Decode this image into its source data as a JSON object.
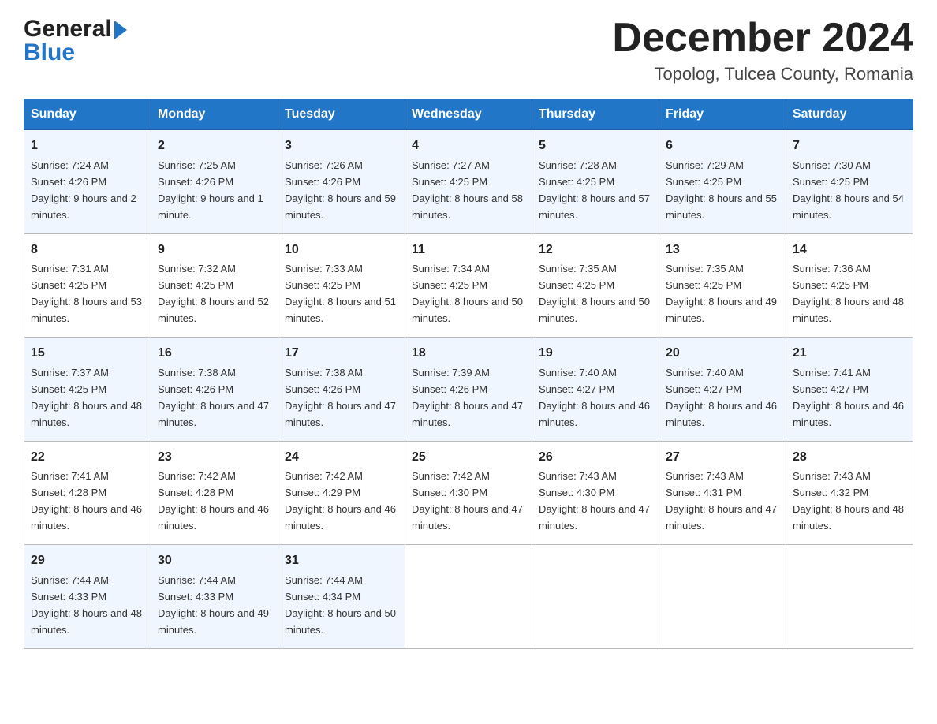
{
  "header": {
    "logo_general": "General",
    "logo_blue": "Blue",
    "title": "December 2024",
    "subtitle": "Topolog, Tulcea County, Romania"
  },
  "days_of_week": [
    "Sunday",
    "Monday",
    "Tuesday",
    "Wednesday",
    "Thursday",
    "Friday",
    "Saturday"
  ],
  "weeks": [
    [
      {
        "day": "1",
        "sunrise": "7:24 AM",
        "sunset": "4:26 PM",
        "daylight": "9 hours and 2 minutes."
      },
      {
        "day": "2",
        "sunrise": "7:25 AM",
        "sunset": "4:26 PM",
        "daylight": "9 hours and 1 minute."
      },
      {
        "day": "3",
        "sunrise": "7:26 AM",
        "sunset": "4:26 PM",
        "daylight": "8 hours and 59 minutes."
      },
      {
        "day": "4",
        "sunrise": "7:27 AM",
        "sunset": "4:25 PM",
        "daylight": "8 hours and 58 minutes."
      },
      {
        "day": "5",
        "sunrise": "7:28 AM",
        "sunset": "4:25 PM",
        "daylight": "8 hours and 57 minutes."
      },
      {
        "day": "6",
        "sunrise": "7:29 AM",
        "sunset": "4:25 PM",
        "daylight": "8 hours and 55 minutes."
      },
      {
        "day": "7",
        "sunrise": "7:30 AM",
        "sunset": "4:25 PM",
        "daylight": "8 hours and 54 minutes."
      }
    ],
    [
      {
        "day": "8",
        "sunrise": "7:31 AM",
        "sunset": "4:25 PM",
        "daylight": "8 hours and 53 minutes."
      },
      {
        "day": "9",
        "sunrise": "7:32 AM",
        "sunset": "4:25 PM",
        "daylight": "8 hours and 52 minutes."
      },
      {
        "day": "10",
        "sunrise": "7:33 AM",
        "sunset": "4:25 PM",
        "daylight": "8 hours and 51 minutes."
      },
      {
        "day": "11",
        "sunrise": "7:34 AM",
        "sunset": "4:25 PM",
        "daylight": "8 hours and 50 minutes."
      },
      {
        "day": "12",
        "sunrise": "7:35 AM",
        "sunset": "4:25 PM",
        "daylight": "8 hours and 50 minutes."
      },
      {
        "day": "13",
        "sunrise": "7:35 AM",
        "sunset": "4:25 PM",
        "daylight": "8 hours and 49 minutes."
      },
      {
        "day": "14",
        "sunrise": "7:36 AM",
        "sunset": "4:25 PM",
        "daylight": "8 hours and 48 minutes."
      }
    ],
    [
      {
        "day": "15",
        "sunrise": "7:37 AM",
        "sunset": "4:25 PM",
        "daylight": "8 hours and 48 minutes."
      },
      {
        "day": "16",
        "sunrise": "7:38 AM",
        "sunset": "4:26 PM",
        "daylight": "8 hours and 47 minutes."
      },
      {
        "day": "17",
        "sunrise": "7:38 AM",
        "sunset": "4:26 PM",
        "daylight": "8 hours and 47 minutes."
      },
      {
        "day": "18",
        "sunrise": "7:39 AM",
        "sunset": "4:26 PM",
        "daylight": "8 hours and 47 minutes."
      },
      {
        "day": "19",
        "sunrise": "7:40 AM",
        "sunset": "4:27 PM",
        "daylight": "8 hours and 46 minutes."
      },
      {
        "day": "20",
        "sunrise": "7:40 AM",
        "sunset": "4:27 PM",
        "daylight": "8 hours and 46 minutes."
      },
      {
        "day": "21",
        "sunrise": "7:41 AM",
        "sunset": "4:27 PM",
        "daylight": "8 hours and 46 minutes."
      }
    ],
    [
      {
        "day": "22",
        "sunrise": "7:41 AM",
        "sunset": "4:28 PM",
        "daylight": "8 hours and 46 minutes."
      },
      {
        "day": "23",
        "sunrise": "7:42 AM",
        "sunset": "4:28 PM",
        "daylight": "8 hours and 46 minutes."
      },
      {
        "day": "24",
        "sunrise": "7:42 AM",
        "sunset": "4:29 PM",
        "daylight": "8 hours and 46 minutes."
      },
      {
        "day": "25",
        "sunrise": "7:42 AM",
        "sunset": "4:30 PM",
        "daylight": "8 hours and 47 minutes."
      },
      {
        "day": "26",
        "sunrise": "7:43 AM",
        "sunset": "4:30 PM",
        "daylight": "8 hours and 47 minutes."
      },
      {
        "day": "27",
        "sunrise": "7:43 AM",
        "sunset": "4:31 PM",
        "daylight": "8 hours and 47 minutes."
      },
      {
        "day": "28",
        "sunrise": "7:43 AM",
        "sunset": "4:32 PM",
        "daylight": "8 hours and 48 minutes."
      }
    ],
    [
      {
        "day": "29",
        "sunrise": "7:44 AM",
        "sunset": "4:33 PM",
        "daylight": "8 hours and 48 minutes."
      },
      {
        "day": "30",
        "sunrise": "7:44 AM",
        "sunset": "4:33 PM",
        "daylight": "8 hours and 49 minutes."
      },
      {
        "day": "31",
        "sunrise": "7:44 AM",
        "sunset": "4:34 PM",
        "daylight": "8 hours and 50 minutes."
      },
      null,
      null,
      null,
      null
    ]
  ],
  "labels": {
    "sunrise": "Sunrise:",
    "sunset": "Sunset:",
    "daylight": "Daylight:"
  }
}
